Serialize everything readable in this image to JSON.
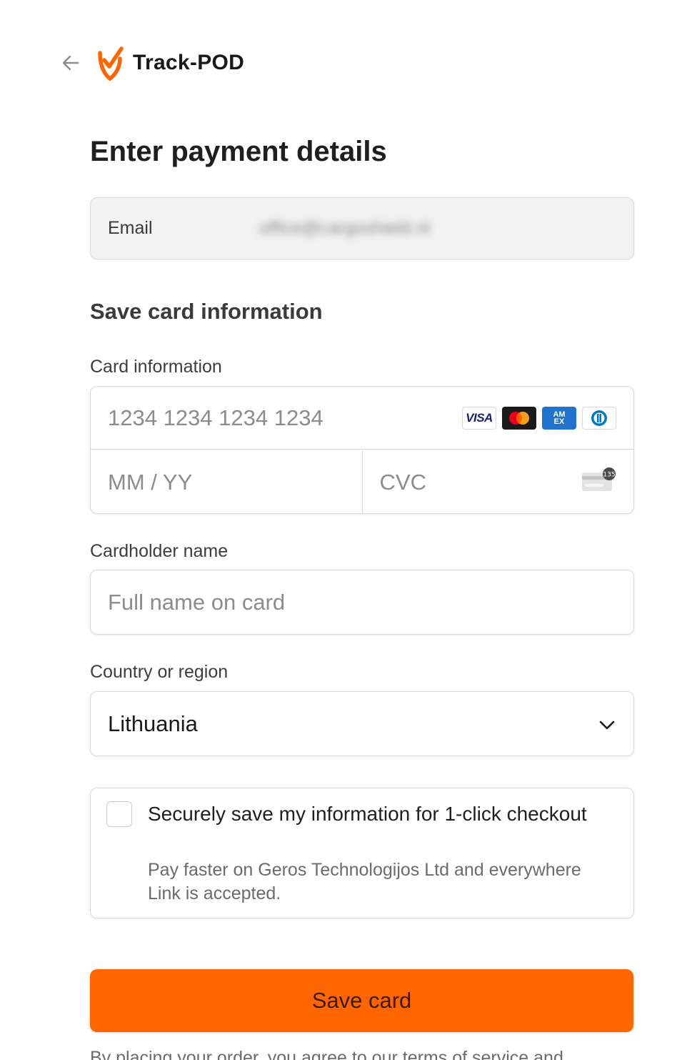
{
  "header": {
    "back_icon": "arrow-left-icon",
    "logo_icon": "checkmark-shield-logo",
    "brand_name": "Track-POD",
    "brand_color": "#ff6600"
  },
  "main": {
    "title": "Enter payment details",
    "email": {
      "label": "Email",
      "value": "office@cargoshield.nl"
    },
    "section_title": "Save card information",
    "card": {
      "label": "Card information",
      "number_placeholder": "1234 1234 1234 1234",
      "expiry_placeholder": "MM / YY",
      "cvc_placeholder": "CVC",
      "brands": [
        "VISA",
        "Mastercard",
        "American Express",
        "Diners Club"
      ],
      "visa_text": "VISA",
      "amex_text_top": "AM",
      "amex_text_bottom": "EX",
      "cvc_icon": "credit-card-cvc-icon",
      "cvc_badge": "135"
    },
    "cardholder": {
      "label": "Cardholder name",
      "placeholder": "Full name on card"
    },
    "country": {
      "label": "Country or region",
      "value": "Lithuania",
      "chevron_icon": "chevron-down-icon"
    },
    "save_info": {
      "checked": false,
      "title": "Securely save my information for 1-click checkout",
      "description": "Pay faster on Geros Technologijos Ltd and everywhere Link is accepted."
    },
    "submit_label": "Save card",
    "submit_color": "#ff6600",
    "terms_text": "By placing your order, you agree to our terms of service and"
  }
}
